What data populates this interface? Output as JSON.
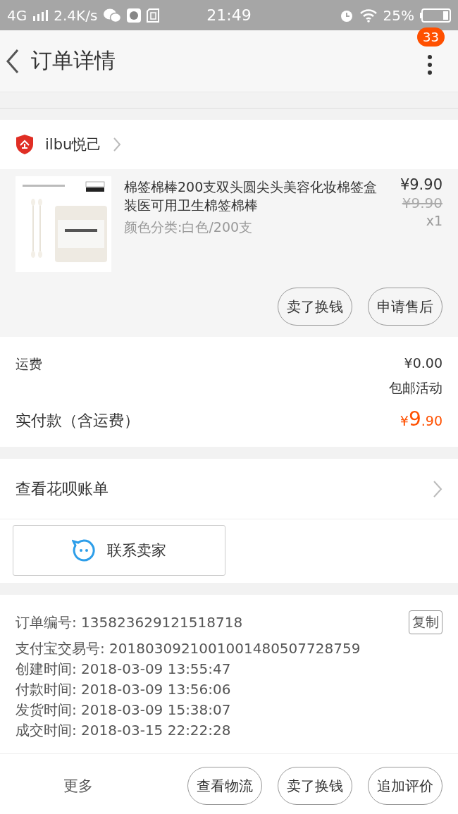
{
  "status_bar": {
    "network": "4G",
    "speed": "2.4K/s",
    "time": "21:49",
    "battery": "25%"
  },
  "header": {
    "title": "订单详情",
    "badge": "33"
  },
  "shop": {
    "name": "ilbu悦己"
  },
  "product": {
    "title": "棉签棉棒200支双头圆尖头美容化妆棉签盒装医可用卫生棉签棉棒",
    "variant": "颜色分类:白色/200支",
    "price": "¥9.90",
    "original_price": "¥9.90",
    "quantity": "x1",
    "actions": [
      "卖了换钱",
      "申请售后"
    ]
  },
  "fees": {
    "shipping_label": "运费",
    "shipping_value": "¥0.00",
    "shipping_note": "包邮活动",
    "total_label": "实付款（含运费）",
    "total_currency": "¥",
    "total_int": "9",
    "total_dec": ".90"
  },
  "huabei": {
    "label": "查看花呗账单"
  },
  "contact": {
    "label": "联系卖家"
  },
  "order_info": {
    "copy": "复制",
    "rows": [
      {
        "label": "订单编号:",
        "value": "135823629121518718"
      },
      {
        "label": "支付宝交易号:",
        "value": "2018030921001001480507728759"
      },
      {
        "label": "创建时间:",
        "value": "2018-03-09 13:55:47"
      },
      {
        "label": "付款时间:",
        "value": "2018-03-09 13:56:06"
      },
      {
        "label": "发货时间:",
        "value": "2018-03-09 15:38:07"
      },
      {
        "label": "成交时间:",
        "value": "2018-03-15 22:22:28"
      }
    ]
  },
  "bottom_bar": {
    "more": "更多",
    "actions": [
      "查看物流",
      "卖了换钱",
      "追加评价"
    ]
  }
}
